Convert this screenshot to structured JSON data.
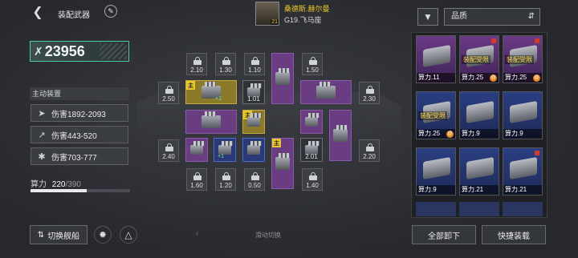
{
  "header": {
    "back_icon": "back-chevron-icon",
    "title": "装配武器",
    "edit_icon": "pen-icon"
  },
  "captain": {
    "name": "桑德斯.赫尔曼",
    "level": "21",
    "ship": "G19.飞马座"
  },
  "power": {
    "value": "23956",
    "icon": "crossed-swords-icon"
  },
  "active": {
    "label": "主动装置",
    "stats": [
      {
        "icon": "missile-icon",
        "text": "伤害1892-2093"
      },
      {
        "icon": "syringe-icon",
        "text": "伤害443-520"
      },
      {
        "icon": "claw-icon",
        "text": "伤害703-777"
      }
    ]
  },
  "capacity": {
    "label": "算力",
    "used": "220",
    "total": "/390",
    "used_fraction": 0.564
  },
  "slots": {
    "locked": [
      "2.10",
      "1.30",
      "1.10",
      "1.50",
      "2.50",
      "2.30",
      "2.40",
      "2.20",
      "1.60",
      "1.20",
      "0.50",
      "1.40"
    ],
    "weapons": [
      "1.01",
      "2.01",
      "+1",
      "+1"
    ],
    "main_badge": "主",
    "bolt": "lightning-icon"
  },
  "hint": {
    "text": "滑动切换"
  },
  "filter": {
    "icon": "filter-icon",
    "select": "品质",
    "sort_icon": "sort-icon"
  },
  "inventory": [
    {
      "power": "算力.11",
      "rarity": "purple",
      "warn": "",
      "ost": "",
      "mark": false
    },
    {
      "power": "算力.25",
      "rarity": "purple",
      "warn": "装配受限",
      "ost": "@",
      "mark": true
    },
    {
      "power": "算力.25",
      "rarity": "purple",
      "warn": "装配受限",
      "ost": "@",
      "mark": true
    },
    {
      "power": "算力.25",
      "rarity": "blue",
      "warn": "装配受限",
      "ost": "@",
      "mark": false
    },
    {
      "power": "算力.9",
      "rarity": "blue",
      "warn": "",
      "ost": "",
      "mark": false
    },
    {
      "power": "算力.9",
      "rarity": "blue",
      "warn": "",
      "ost": "",
      "mark": false
    },
    {
      "power": "算力.9",
      "rarity": "blue",
      "warn": "",
      "ost": "",
      "mark": false
    },
    {
      "power": "算力.21",
      "rarity": "blue",
      "warn": "",
      "ost": "",
      "mark": false
    },
    {
      "power": "算力.21",
      "rarity": "blue",
      "warn": "",
      "ost": "",
      "mark": true
    }
  ],
  "footer": {
    "switch_ship": "切换舰船",
    "unload_all": "全部卸下",
    "quick_equip": "快捷装载"
  }
}
